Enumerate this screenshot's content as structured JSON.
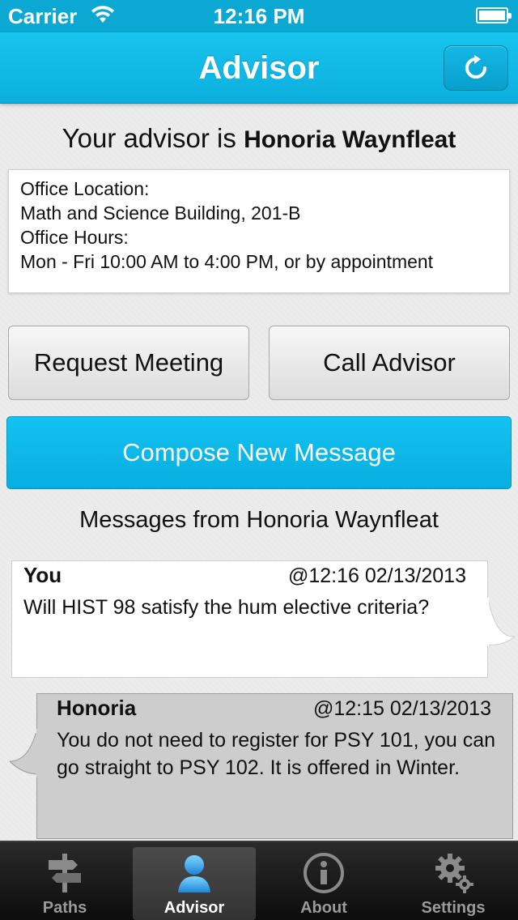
{
  "status_bar": {
    "carrier": "Carrier",
    "time": "12:16 PM"
  },
  "nav": {
    "title": "Advisor",
    "refresh_icon": "refresh-icon"
  },
  "advisor": {
    "prefix": "Your advisor is",
    "name": "Honoria Waynfleat"
  },
  "office": {
    "location_label": "Office Location:",
    "location": "Math and Science Building, 201-B",
    "hours_label": "Office Hours:",
    "hours": "Mon - Fri 10:00 AM to 4:00 PM, or by appointment"
  },
  "actions": {
    "request_meeting": "Request Meeting",
    "call_advisor": "Call Advisor",
    "compose": "Compose New Message"
  },
  "messages_heading": "Messages from Honoria Waynfleat",
  "messages": [
    {
      "sender": "You",
      "time": "@12:16 02/13/2013",
      "body": "Will HIST 98 satisfy the hum elective criteria?"
    },
    {
      "sender": "Honoria",
      "time": "@12:15 02/13/2013",
      "body": "You do not need to register for PSY 101, you can go straight to PSY 102. It is offered in Winter."
    }
  ],
  "tabs": [
    {
      "label": "Paths",
      "icon": "signpost-icon"
    },
    {
      "label": "Advisor",
      "icon": "person-icon",
      "selected": true
    },
    {
      "label": "About",
      "icon": "info-icon"
    },
    {
      "label": "Settings",
      "icon": "gear-icon"
    }
  ],
  "colors": {
    "accent": "#0baede",
    "tab_bar": "#111111"
  }
}
